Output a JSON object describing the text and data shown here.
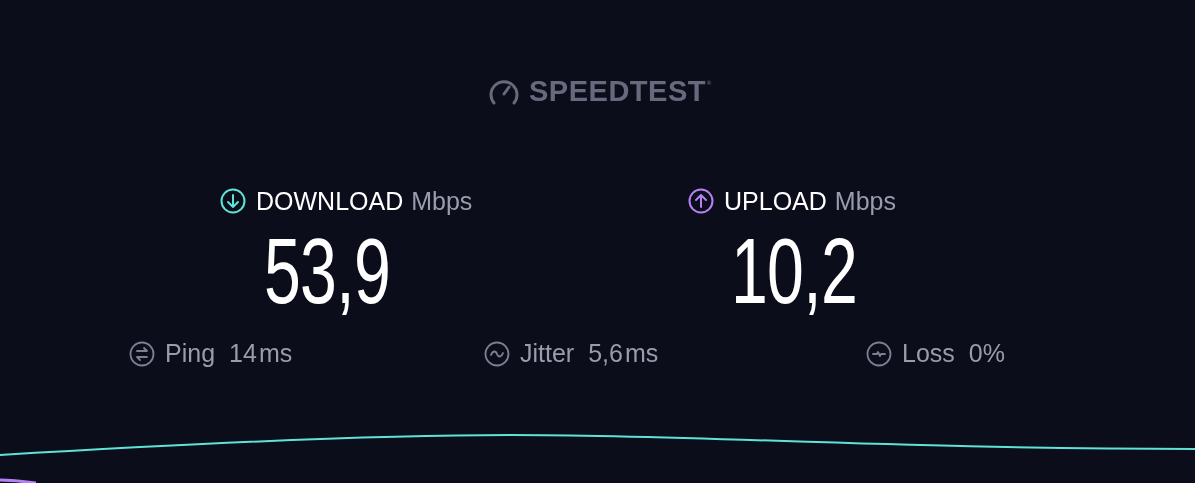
{
  "logo": {
    "text": "SPEEDTEST",
    "mark": "®"
  },
  "metrics": [
    {
      "kind": "download",
      "label": "DOWNLOAD",
      "unit": "Mbps",
      "value": "53,9",
      "color": "#5fe3d6"
    },
    {
      "kind": "upload",
      "label": "UPLOAD",
      "unit": "Mbps",
      "value": "10,2",
      "color": "#b780f6"
    }
  ],
  "stats": [
    {
      "kind": "ping",
      "label": "Ping",
      "value": "14",
      "unit": "ms"
    },
    {
      "kind": "jitter",
      "label": "Jitter",
      "value": "5,6",
      "unit": "ms"
    },
    {
      "kind": "loss",
      "label": "Loss",
      "value": "0%"
    }
  ]
}
